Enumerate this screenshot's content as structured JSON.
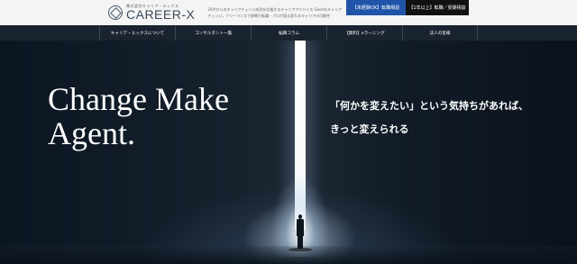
{
  "header": {
    "logo_sub": "株式会社キャリア・エックス",
    "logo_main": "CAREER-X",
    "tagline": "20代からのキャリアチェンジ成功を応援するキャリアアドバイス Goodなキャリアチェンジ。フリーランスで即戦力転職・プロが語る変わるキャリアの可能性",
    "cta_blue": "【未経験OK】転職相談",
    "cta_dark": "【1年以上】転職／受験相談"
  },
  "nav": {
    "items": [
      "キャリア・エックスについて",
      "コンサルタント一覧",
      "転職コラム",
      "【無料】eラーニング",
      "法人の皆様"
    ]
  },
  "hero": {
    "title_line1": "Change Make",
    "title_line2": "Agent.",
    "copy_line1": "「何かを変えたい」という気持ちがあれば、",
    "copy_line2": "きっと変えられる"
  },
  "colors": {
    "cta_blue": "#1f54a9",
    "cta_dark": "#111111",
    "nav_bg": "#1a2330",
    "hero_bg": "#0c1522"
  },
  "icons": {
    "logo": "career-x-logo-mark"
  }
}
